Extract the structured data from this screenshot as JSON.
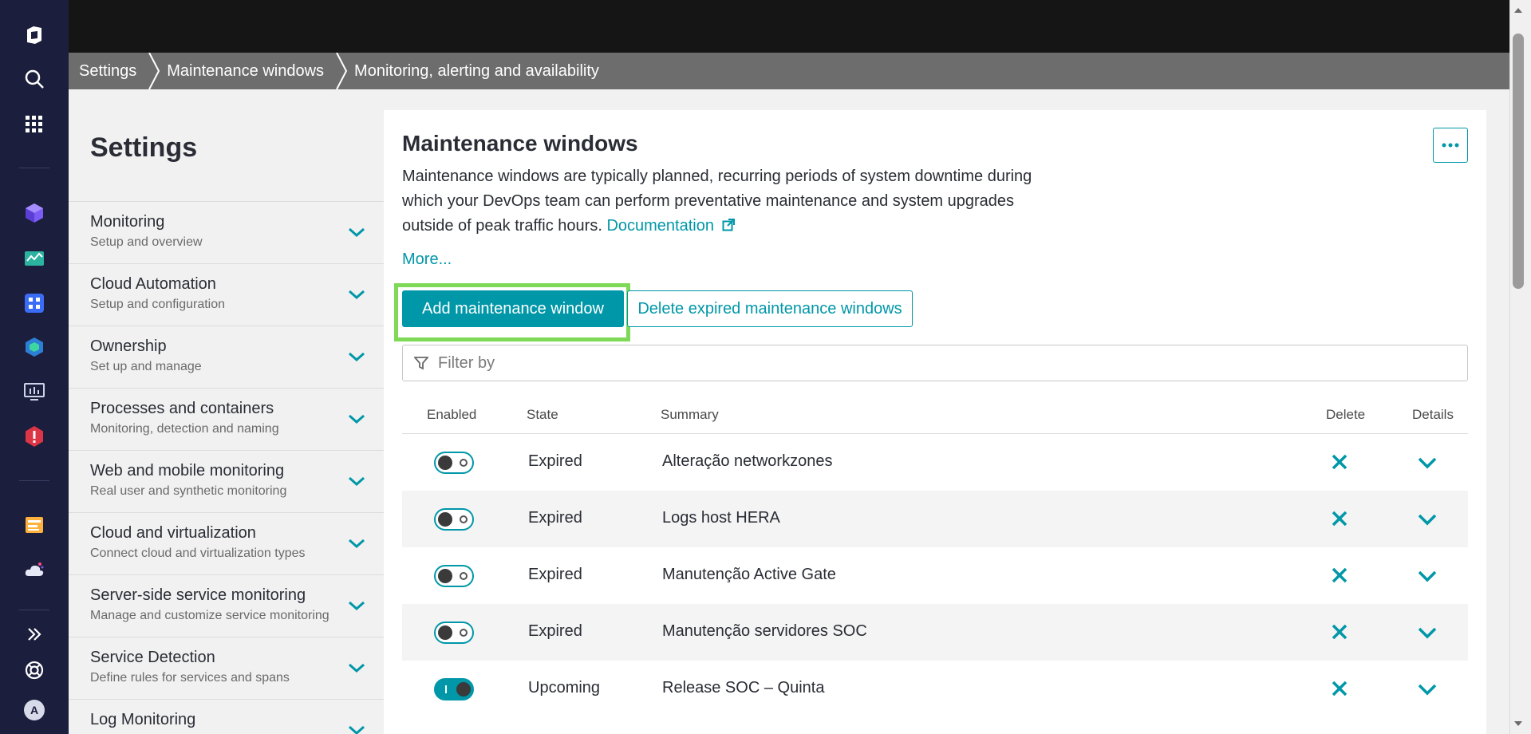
{
  "breadcrumbs": [
    "Settings",
    "Maintenance windows",
    "Monitoring, alerting and availability"
  ],
  "rail_icons": [
    "dynatrace-logo-icon",
    "search-icon",
    "apps-grid-icon",
    "cube-app-icon",
    "dashboard-app-icon",
    "services-app-icon",
    "hexagon-app-icon",
    "monitor-app-icon",
    "alert-app-icon",
    "notebook-app-icon",
    "cloud-app-icon",
    "expand-icon",
    "help-icon",
    "user-avatar"
  ],
  "user_initial": "A",
  "sidebar": {
    "title": "Settings",
    "items": [
      {
        "title": "Monitoring",
        "subtitle": "Setup and overview"
      },
      {
        "title": "Cloud Automation",
        "subtitle": "Setup and configuration"
      },
      {
        "title": "Ownership",
        "subtitle": "Set up and manage"
      },
      {
        "title": "Processes and containers",
        "subtitle": "Monitoring, detection and naming"
      },
      {
        "title": "Web and mobile monitoring",
        "subtitle": "Real user and synthetic monitoring"
      },
      {
        "title": "Cloud and virtualization",
        "subtitle": "Connect cloud and virtualization types"
      },
      {
        "title": "Server-side service monitoring",
        "subtitle": "Manage and customize service monitoring"
      },
      {
        "title": "Service Detection",
        "subtitle": "Define rules for services and spans"
      },
      {
        "title": "Log Monitoring",
        "subtitle": ""
      }
    ]
  },
  "main": {
    "title": "Maintenance windows",
    "description": "Maintenance windows are typically planned, recurring periods of system downtime during which your DevOps team can perform preventative maintenance and system upgrades outside of peak traffic hours.",
    "doc_link": "Documentation",
    "more_link": "More...",
    "add_button": "Add maintenance window",
    "delete_expired_button": "Delete expired maintenance windows",
    "filter_placeholder": "Filter by",
    "columns": {
      "enabled": "Enabled",
      "state": "State",
      "summary": "Summary",
      "delete": "Delete",
      "details": "Details"
    },
    "rows": [
      {
        "enabled": false,
        "state": "Expired",
        "summary": "Alteração networkzones"
      },
      {
        "enabled": false,
        "state": "Expired",
        "summary": "Logs host HERA"
      },
      {
        "enabled": false,
        "state": "Expired",
        "summary": "Manutenção Active Gate"
      },
      {
        "enabled": false,
        "state": "Expired",
        "summary": "Manutenção servidores SOC"
      },
      {
        "enabled": true,
        "state": "Upcoming",
        "summary": "Release SOC – Quinta"
      }
    ]
  },
  "colors": {
    "accent": "#0097a8",
    "highlight": "#7ed957",
    "rail": "#1b1e3c"
  }
}
